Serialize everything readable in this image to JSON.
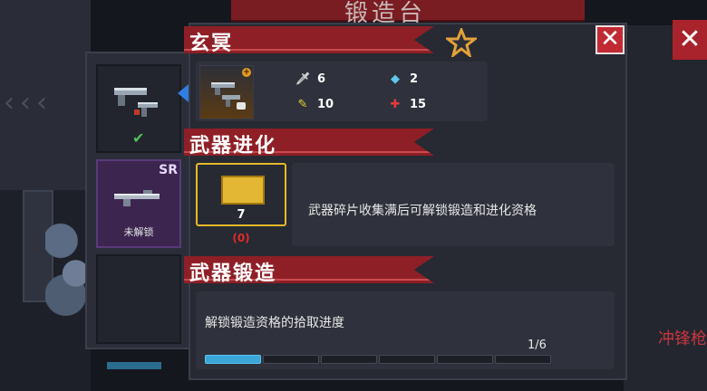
{
  "background": {
    "title": "锻造台",
    "right_labels": [
      "冲锋枪"
    ]
  },
  "weapon_list": {
    "slots": [
      {
        "state": "equipped",
        "check_icon": "check-icon"
      },
      {
        "rarity": "SR",
        "label": "未解锁"
      },
      {
        "state": "empty"
      }
    ]
  },
  "panel": {
    "weapon_name": "玄冥",
    "close_symbol": "✕",
    "stats": {
      "attack": "6",
      "energy": "2",
      "crit": "10",
      "accuracy": "15"
    },
    "evolution": {
      "title": "武器进化",
      "fragments_owned": "7",
      "fragments_need": "(0)",
      "description": "武器碎片收集满后可解锁锻造和进化资格"
    },
    "forge": {
      "title": "武器锻造",
      "description": "解锁锻造资格的拾取进度",
      "progress_text": "1/6",
      "progress_fraction": 0.1667
    }
  },
  "colors": {
    "accent_red": "#8e1f26",
    "progress_blue": "#3ba6d8",
    "select_blue": "#2f7ee0",
    "success_green": "#4ec15a",
    "warning_red": "#e02b2b"
  }
}
